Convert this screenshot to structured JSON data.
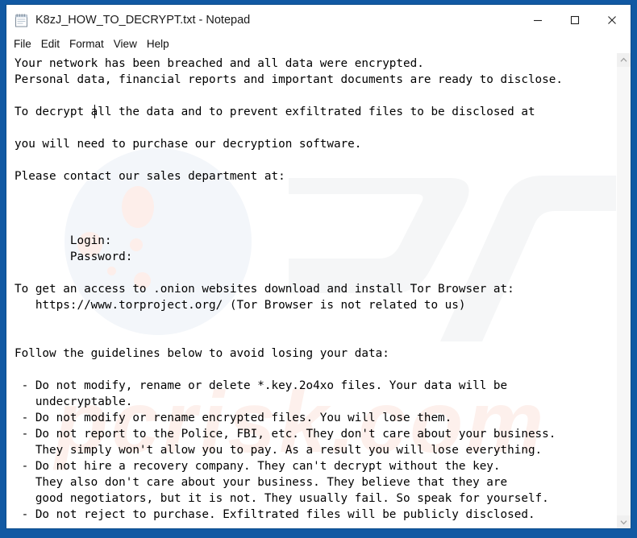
{
  "window": {
    "title": "K8zJ_HOW_TO_DECRYPT.txt - Notepad",
    "app_icon": "notepad-icon",
    "frame_color": "#1159a3",
    "controls": {
      "minimize": "minimize-icon",
      "maximize": "maximize-icon",
      "close": "close-icon"
    }
  },
  "menu": {
    "items": [
      {
        "label": "File"
      },
      {
        "label": "Edit"
      },
      {
        "label": "Format"
      },
      {
        "label": "View"
      },
      {
        "label": "Help"
      }
    ]
  },
  "document": {
    "content": "Your network has been breached and all data were encrypted.\nPersonal data, financial reports and important documents are ready to disclose.\n\nTo decrypt all the data and to prevent exfiltrated files to be disclosed at\n\nyou will need to purchase our decryption software.\n\nPlease contact our sales department at:\n\n\n\n        Login:\n        Password:\n\nTo get an access to .onion websites download and install Tor Browser at:\n   https://www.torproject.org/ (Tor Browser is not related to us)\n\n\nFollow the guidelines below to avoid losing your data:\n\n - Do not modify, rename or delete *.key.2o4xo files. Your data will be\n   undecryptable.\n - Do not modify or rename encrypted files. You will lose them.\n - Do not report to the Police, FBI, etc. They don't care about your business.\n   They simply won't allow you to pay. As a result you will lose everything.\n - Do not hire a recovery company. They can't decrypt without the key.\n   They also don't care about your business. They believe that they are\n   good negotiators, but it is not. They usually fail. So speak for yourself.\n - Do not reject to purchase. Exfiltrated files will be publicly disclosed.",
    "lines": [
      "Your network has been breached and all data were encrypted.",
      "Personal data, financial reports and important documents are ready to disclose.",
      "",
      "To decrypt all the data and to prevent exfiltrated files to be disclosed at",
      "",
      "you will need to purchase our decryption software.",
      "",
      "Please contact our sales department at:",
      "",
      "",
      "",
      "        Login:",
      "        Password:",
      "",
      "To get an access to .onion websites download and install Tor Browser at:",
      "   https://www.torproject.org/ (Tor Browser is not related to us)",
      "",
      "",
      "Follow the guidelines below to avoid losing your data:",
      "",
      " - Do not modify, rename or delete *.key.2o4xo files. Your data will be",
      "   undecryptable.",
      " - Do not modify or rename encrypted files. You will lose them.",
      " - Do not report to the Police, FBI, etc. They don't care about your business.",
      "   They simply won't allow you to pay. As a result you will lose everything.",
      " - Do not hire a recovery company. They can't decrypt without the key.",
      "   They also don't care about your business. They believe that they are",
      "   good negotiators, but it is not. They usually fail. So speak for yourself.",
      " - Do not reject to purchase. Exfiltrated files will be publicly disclosed."
    ],
    "ransom_extension": "*.key.2o4xo",
    "tor_url": "https://www.torproject.org/",
    "credential_labels": {
      "login": "Login:",
      "password": "Password:"
    },
    "text_color": "#000000",
    "background_color": "#ffffff"
  },
  "scrollbar": {
    "up_arrow": "chevron-up-icon",
    "down_arrow": "chevron-down-icon"
  }
}
